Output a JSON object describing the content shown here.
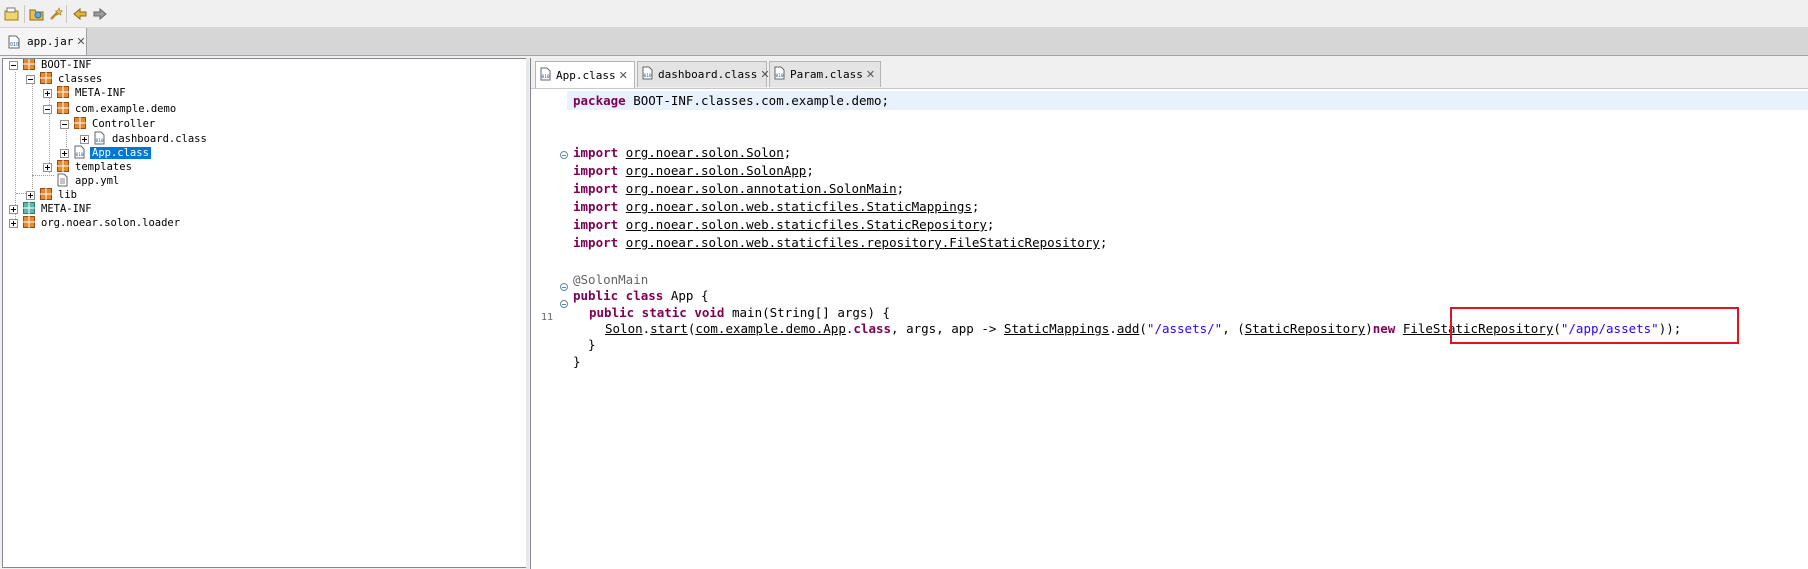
{
  "toolbar": {
    "buttons": [
      {
        "name": "open-file-icon"
      },
      {
        "name": "open-folder-icon"
      },
      {
        "name": "wand-icon"
      },
      {
        "name": "back-arrow-icon"
      },
      {
        "name": "forward-arrow-icon"
      }
    ]
  },
  "outer_tab": {
    "label": "app.jar"
  },
  "tree": {
    "items": [
      {
        "label": "BOOT-INF"
      },
      {
        "label": "classes"
      },
      {
        "label": "META-INF"
      },
      {
        "label": "com.example.demo"
      },
      {
        "label": "Controller"
      },
      {
        "label": "dashboard.class"
      },
      {
        "label": "App.class"
      },
      {
        "label": "templates"
      },
      {
        "label": "app.yml"
      },
      {
        "label": "lib"
      },
      {
        "label": "META-INF"
      },
      {
        "label": "org.noear.solon.loader"
      }
    ]
  },
  "editor": {
    "tabs": [
      {
        "label": "App.class"
      },
      {
        "label": "dashboard.class"
      },
      {
        "label": "Param.class"
      }
    ],
    "line_number_label": "11",
    "code": {
      "line1": {
        "kw": "package",
        "rest": " BOOT-INF.classes.com.example.demo;"
      },
      "imports": [
        {
          "kw": "import",
          "name": "org.noear.solon.Solon",
          "end": ";"
        },
        {
          "kw": "import",
          "name": "org.noear.solon.SolonApp",
          "end": ";"
        },
        {
          "kw": "import",
          "name": "org.noear.solon.annotation.SolonMain",
          "end": ";"
        },
        {
          "kw": "import",
          "name": "org.noear.solon.web.staticfiles.StaticMappings",
          "end": ";"
        },
        {
          "kw": "import",
          "name": "org.noear.solon.web.staticfiles.StaticRepository",
          "end": ";"
        },
        {
          "kw": "import",
          "name": "org.noear.solon.web.staticfiles.repository.FileStaticRepository",
          "end": ";"
        }
      ],
      "annotation": "@SolonMain",
      "class_decl": {
        "kw": "public class",
        "rest": " App {"
      },
      "method_decl": {
        "kw": "public static void",
        "rest": " main(String[] args) {"
      },
      "stmt": {
        "t1": "Solon",
        "t2": ".",
        "t3": "start",
        "t4": "(",
        "t5": "com.example.demo.App",
        "t6": ".",
        "t7": "class",
        "t8": ", args, app -> ",
        "t9": "StaticMappings",
        "t10": ".",
        "t11": "add",
        "t12": "(",
        "t13": "\"/assets/\"",
        "t14": ", (",
        "t15": "StaticRepository",
        "t16": ")",
        "t17": "new",
        "t18": " ",
        "t19": "FileStaticRepository",
        "t20": "(",
        "t21": "\"/app/assets\"",
        "t22": "));"
      },
      "close_method": "  }",
      "close_class": "}"
    }
  },
  "colors": {
    "keyword": "#7f0055",
    "string": "#2a00ff",
    "annotation": "#646464",
    "selection": "#0078d7",
    "highlight_box": "#e0151f"
  }
}
